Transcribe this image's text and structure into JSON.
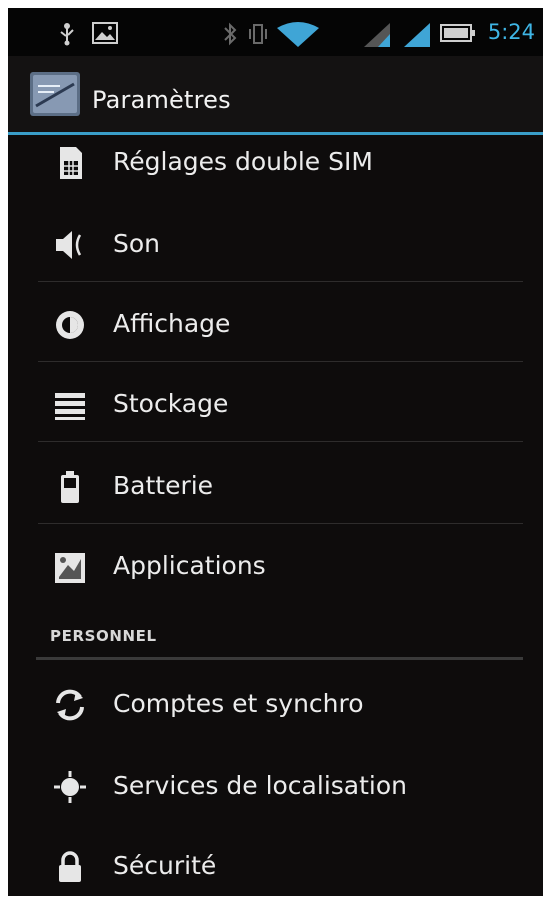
{
  "status_bar": {
    "time": "5:24",
    "icons": [
      "usb-icon",
      "image-icon",
      "bluetooth-icon",
      "vibrate-icon",
      "wifi-icon",
      "signal-sim1-icon",
      "signal-sim2-icon",
      "battery-icon"
    ]
  },
  "action_bar": {
    "title": "Paramètres",
    "icon": "settings-app-icon"
  },
  "settings": {
    "items": [
      {
        "label": "Réglages double SIM",
        "icon": "sim-card-icon"
      },
      {
        "label": "Son",
        "icon": "speaker-icon"
      },
      {
        "label": "Affichage",
        "icon": "brightness-icon"
      },
      {
        "label": "Stockage",
        "icon": "storage-icon"
      },
      {
        "label": "Batterie",
        "icon": "battery-icon"
      },
      {
        "label": "Applications",
        "icon": "applications-icon"
      }
    ],
    "personal_header": "PERSONNEL",
    "personal_items": [
      {
        "label": "Comptes et synchro",
        "icon": "sync-icon"
      },
      {
        "label": "Services de localisation",
        "icon": "location-icon"
      },
      {
        "label": "Sécurité",
        "icon": "lock-icon"
      }
    ]
  },
  "colors": {
    "accent": "#3fb6e6",
    "background": "#0e0c0c",
    "text": "#ececec"
  }
}
